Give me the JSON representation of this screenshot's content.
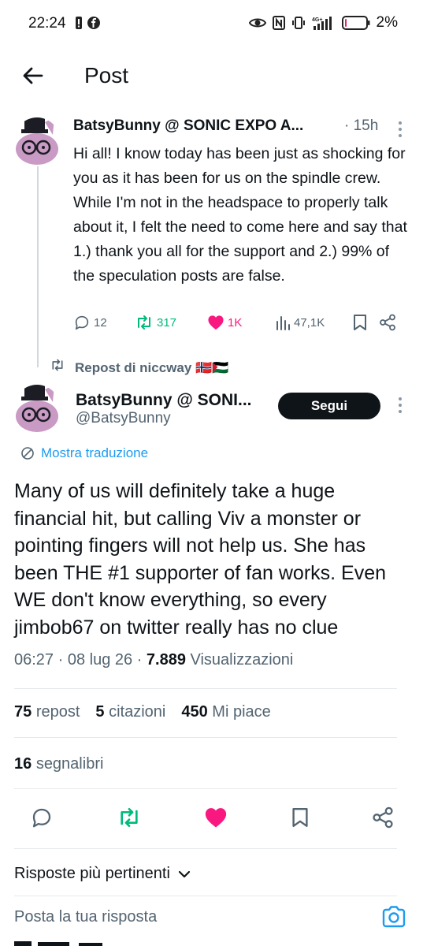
{
  "status_bar": {
    "time": "22:24",
    "battery": "2%",
    "network": "4G+"
  },
  "header": {
    "title": "Post"
  },
  "original_post": {
    "display_name": "BatsyBunny @ SONIC EXPO A...",
    "time": "· 15h",
    "text": "Hi all! I know today has been just as shocking for you as it has been for us on the spindle crew. While I'm not in the headspace to properly talk about it, I felt the need to come here and say that 1.) thank you all for the support and 2.) 99% of the speculation posts are false.",
    "replies": "12",
    "reposts": "317",
    "likes": "1K",
    "views": "47,1K"
  },
  "repost_label": "Repost di niccway 🇳🇴🇵🇸",
  "main_post": {
    "display_name": "BatsyBunny @ SONI...",
    "handle": "@BatsyBunny",
    "follow_label": "Segui",
    "translate_label": "Mostra traduzione",
    "text": "Many of us will definitely take a huge financial hit, but calling Viv a monster or pointing fingers will not help us. She has been THE #1 supporter of fan works. Even WE don't know everything, so every jimbob67 on twitter really has no clue",
    "date": "06:27 · 08 lug 26 · ",
    "views_count": "7.889",
    "views_label": " Visualizzazioni"
  },
  "stats": {
    "reposts_count": "75",
    "reposts_label": "repost",
    "quotes_count": "5",
    "quotes_label": "citazioni",
    "likes_count": "450",
    "likes_label": "Mi piace",
    "bookmarks_count": "16",
    "bookmarks_label": "segnalibri"
  },
  "replies_section": {
    "sort_label": "Risposte più pertinenti",
    "input_placeholder": "Posta la tua risposta"
  },
  "colors": {
    "repost_green": "#00ba7c",
    "like_pink": "#f91880",
    "link_blue": "#1d9bf0",
    "muted": "#536471",
    "text": "#0f1419"
  },
  "icons": [
    "back-arrow-icon",
    "reply-icon",
    "repost-icon",
    "heart-icon",
    "views-icon",
    "bookmark-icon",
    "share-icon",
    "translate-icon",
    "camera-icon",
    "chevron-down-icon",
    "more-icon"
  ]
}
